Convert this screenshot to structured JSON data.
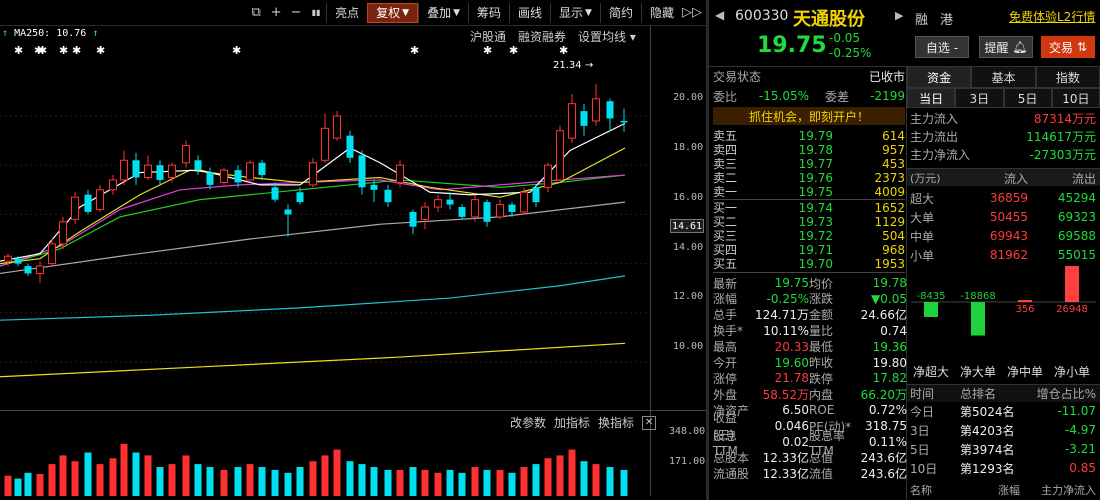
{
  "toolbar": {
    "items": [
      {
        "label": "亮点",
        "arrow": ""
      },
      {
        "label": "复权",
        "arrow": "▼",
        "active": true
      },
      {
        "label": "叠加",
        "arrow": "▼"
      },
      {
        "label": "筹码",
        "arrow": ""
      },
      {
        "label": "画线",
        "arrow": ""
      },
      {
        "label": "显示",
        "arrow": "▼"
      },
      {
        "label": "简约",
        "arrow": ""
      },
      {
        "label": "隐藏",
        "arrow": ""
      }
    ],
    "icons": [
      "+",
      "−",
      "▮▮"
    ]
  },
  "chart": {
    "ma_label": "MA250: 10.76",
    "sub_links": [
      "沪股通",
      "融资融券",
      "设置均线 ▾"
    ],
    "high_marker": "21.34",
    "y_ticks": [
      "20.00",
      "18.00",
      "16.00",
      "14.00",
      "12.00",
      "10.00"
    ],
    "current_price": "14.61",
    "vol_ticks": [
      "348.00",
      "171.00"
    ],
    "indicator_links": [
      "改参数",
      "加指标",
      "换指标"
    ]
  },
  "stock": {
    "code": "600330",
    "name": "天通股份",
    "price": "19.75",
    "change": "-0.05",
    "change_pct": "-0.25%",
    "tags": [
      "融",
      "港"
    ],
    "promo": "免费体验L2行情",
    "btn_watch": "自选 -",
    "btn_alert": "提醒",
    "btn_trade": "交易"
  },
  "status": {
    "label": "交易状态",
    "value": "已收市"
  },
  "wei": {
    "ratio_label": "委比",
    "ratio": "-15.05%",
    "diff_label": "委差",
    "diff": "-2199"
  },
  "banner": "抓住机会，即刻开户！",
  "sell": [
    {
      "l": "卖五",
      "p": "19.79",
      "v": "614"
    },
    {
      "l": "卖四",
      "p": "19.78",
      "v": "957"
    },
    {
      "l": "卖三",
      "p": "19.77",
      "v": "453"
    },
    {
      "l": "卖二",
      "p": "19.76",
      "v": "2373"
    },
    {
      "l": "卖一",
      "p": "19.75",
      "v": "4009"
    }
  ],
  "buy": [
    {
      "l": "买一",
      "p": "19.74",
      "v": "1652"
    },
    {
      "l": "买二",
      "p": "19.73",
      "v": "1129"
    },
    {
      "l": "买三",
      "p": "19.72",
      "v": "504"
    },
    {
      "l": "买四",
      "p": "19.71",
      "v": "968"
    },
    {
      "l": "买五",
      "p": "19.70",
      "v": "1953"
    }
  ],
  "quote": [
    [
      "最新",
      "19.75",
      "均价",
      "19.78"
    ],
    [
      "涨幅",
      "-0.25%",
      "涨跌",
      "▼0.05"
    ],
    [
      "总手",
      "124.71万",
      "金额",
      "24.66亿"
    ],
    [
      "换手*",
      "10.11%",
      "量比",
      "0.74"
    ],
    [
      "最高",
      "20.33",
      "最低",
      "19.36"
    ],
    [
      "今开",
      "19.60",
      "昨收",
      "19.80"
    ],
    [
      "涨停",
      "21.78",
      "跌停",
      "17.82"
    ],
    [
      "外盘",
      "58.52万",
      "内盘",
      "66.20万"
    ],
    [
      "净资产",
      "6.50",
      "ROE",
      "0.72%"
    ],
    [
      "收益(三)",
      "0.046",
      "PE(动)*",
      "318.75"
    ],
    [
      "股息TTM",
      "0.02",
      "股息率TTM",
      "0.11%"
    ],
    [
      "总股本",
      "12.33亿",
      "总值",
      "243.6亿"
    ],
    [
      "流通股",
      "12.33亿",
      "流值",
      "243.6亿"
    ]
  ],
  "fund": {
    "tabs": [
      "资金",
      "基本",
      "指数"
    ],
    "day_tabs": [
      "当日",
      "3日",
      "5日",
      "10日"
    ],
    "main_in_label": "主力流入",
    "main_in": "87314万元",
    "main_out_label": "主力流出",
    "main_out": "114617万元",
    "main_net_label": "主力净流入",
    "main_net": "-27303万元",
    "table_unit": "(万元)",
    "col_in": "流入",
    "col_out": "流出",
    "rows": [
      {
        "n": "超大",
        "i": "36859",
        "o": "45294"
      },
      {
        "n": "大单",
        "i": "50455",
        "o": "69323"
      },
      {
        "n": "中单",
        "i": "69943",
        "o": "69588"
      },
      {
        "n": "小单",
        "i": "81962",
        "o": "55015"
      }
    ],
    "bars": [
      {
        "label": "净超大",
        "value": -8435
      },
      {
        "label": "净大单",
        "value": -18868
      },
      {
        "label": "净中单",
        "value": 356
      },
      {
        "label": "净小单",
        "value": 26948
      }
    ],
    "rank_head": [
      "时间",
      "总排名",
      "增仓占比%"
    ],
    "ranks": [
      {
        "t": "今日",
        "r": "第5024名",
        "p": "-11.07"
      },
      {
        "t": "3日",
        "r": "第4203名",
        "p": "-4.97"
      },
      {
        "t": "5日",
        "r": "第3974名",
        "p": "-3.21"
      },
      {
        "t": "10日",
        "r": "第1293名",
        "p": "0.85"
      }
    ],
    "bottom": [
      "名称",
      "涨幅",
      "主力净流入"
    ]
  }
}
